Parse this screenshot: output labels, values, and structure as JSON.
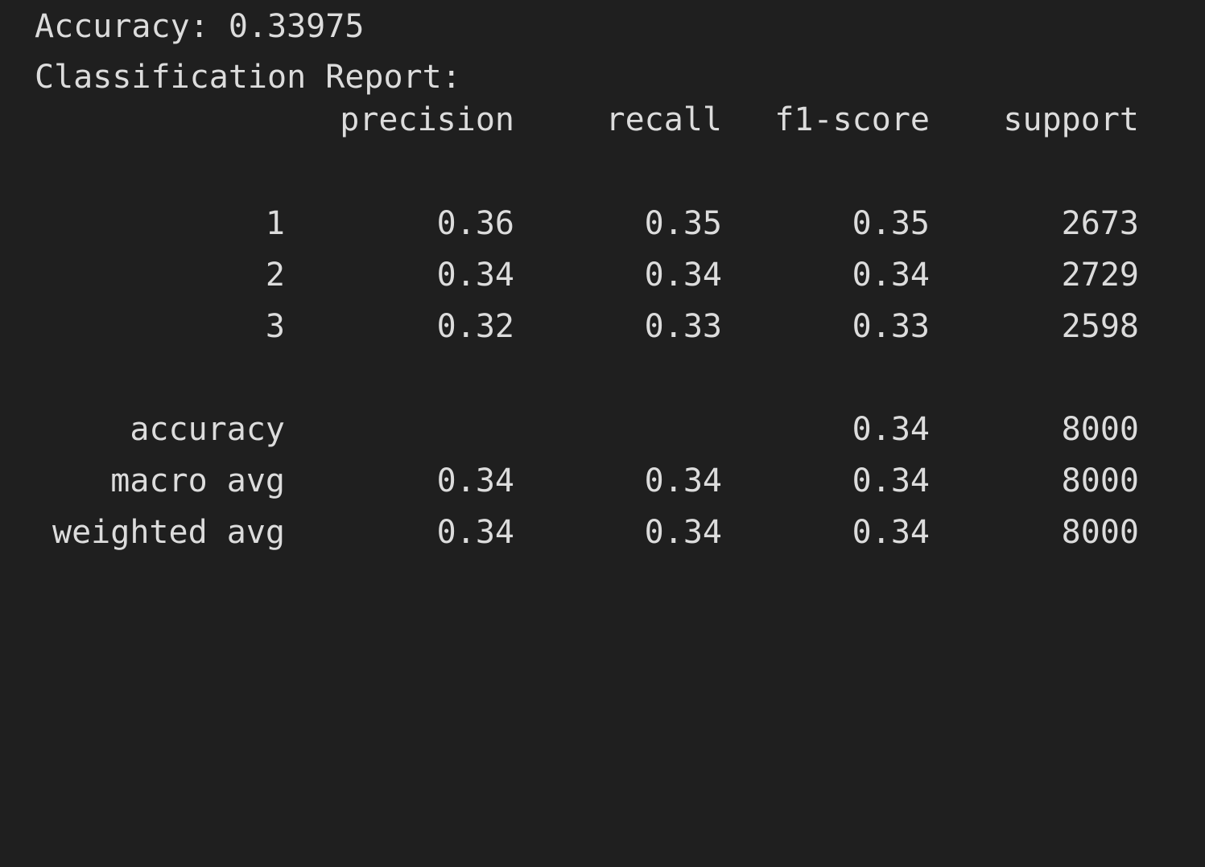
{
  "terminal": {
    "accuracy_line": "Accuracy: 0.33975",
    "report_title": "Classification Report:"
  },
  "report": {
    "headers": [
      "precision",
      "recall",
      "f1-score",
      "support"
    ],
    "rows": [
      {
        "label": "1",
        "precision": "0.36",
        "recall": "0.35",
        "f1": "0.35",
        "support": "2673"
      },
      {
        "label": "2",
        "precision": "0.34",
        "recall": "0.34",
        "f1": "0.34",
        "support": "2729"
      },
      {
        "label": "3",
        "precision": "0.32",
        "recall": "0.33",
        "f1": "0.33",
        "support": "2598"
      }
    ],
    "summary": [
      {
        "label": "accuracy",
        "precision": "",
        "recall": "",
        "f1": "0.34",
        "support": "8000"
      },
      {
        "label": "macro avg",
        "precision": "0.34",
        "recall": "0.34",
        "f1": "0.34",
        "support": "8000"
      },
      {
        "label": "weighted avg",
        "precision": "0.34",
        "recall": "0.34",
        "f1": "0.34",
        "support": "8000"
      }
    ]
  }
}
